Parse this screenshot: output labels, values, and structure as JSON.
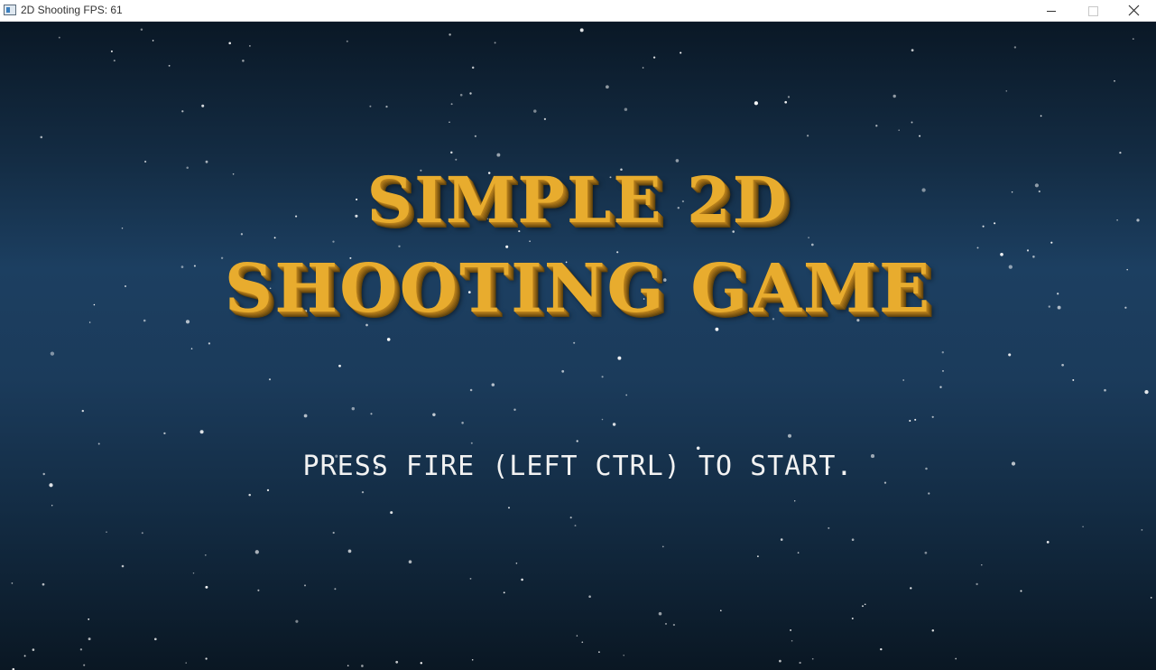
{
  "window": {
    "title": "2D Shooting FPS: 61",
    "icons": [
      "app-icon",
      "minimize-icon",
      "maximize-icon",
      "close-icon"
    ]
  },
  "game": {
    "title_line_1": "SIMPLE 2D",
    "title_line_2": "SHOOTING GAME",
    "start_prompt": "PRESS FIRE (LEFT CTRL) TO START."
  },
  "colors": {
    "title_gold": "#e8ac2e",
    "title_extrude": "#865c12",
    "prompt_text": "#f2f2f2",
    "sky_top": "#0a1826",
    "sky_mid": "#1c3f61",
    "sky_bottom": "#0a1723",
    "star": "#ffffff"
  }
}
